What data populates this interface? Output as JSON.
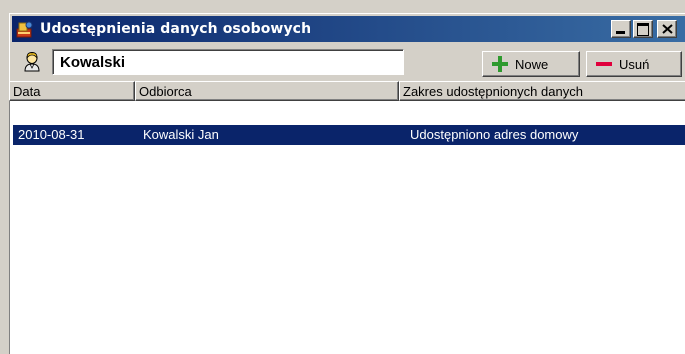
{
  "window": {
    "title": "Udostępnienia danych osobowych",
    "icon": "data-sharing-icon"
  },
  "toolbar": {
    "search_value": "Kowalski",
    "new_label": "Nowe",
    "delete_label": "Usuń"
  },
  "table": {
    "columns": [
      "Data",
      "Odbiorca",
      "Zakres udostępnionych danych"
    ],
    "rows": [
      {
        "date": "2010-08-31",
        "recipient": "Kowalski Jan",
        "scope": "Udostępniono adres domowy",
        "selected": true
      }
    ]
  },
  "colors": {
    "titlebar_start": "#0a246a",
    "titlebar_end": "#3a6ea5",
    "selection": "#0a246a",
    "add_icon": "#2e9a2e",
    "remove_icon": "#e0003c"
  }
}
